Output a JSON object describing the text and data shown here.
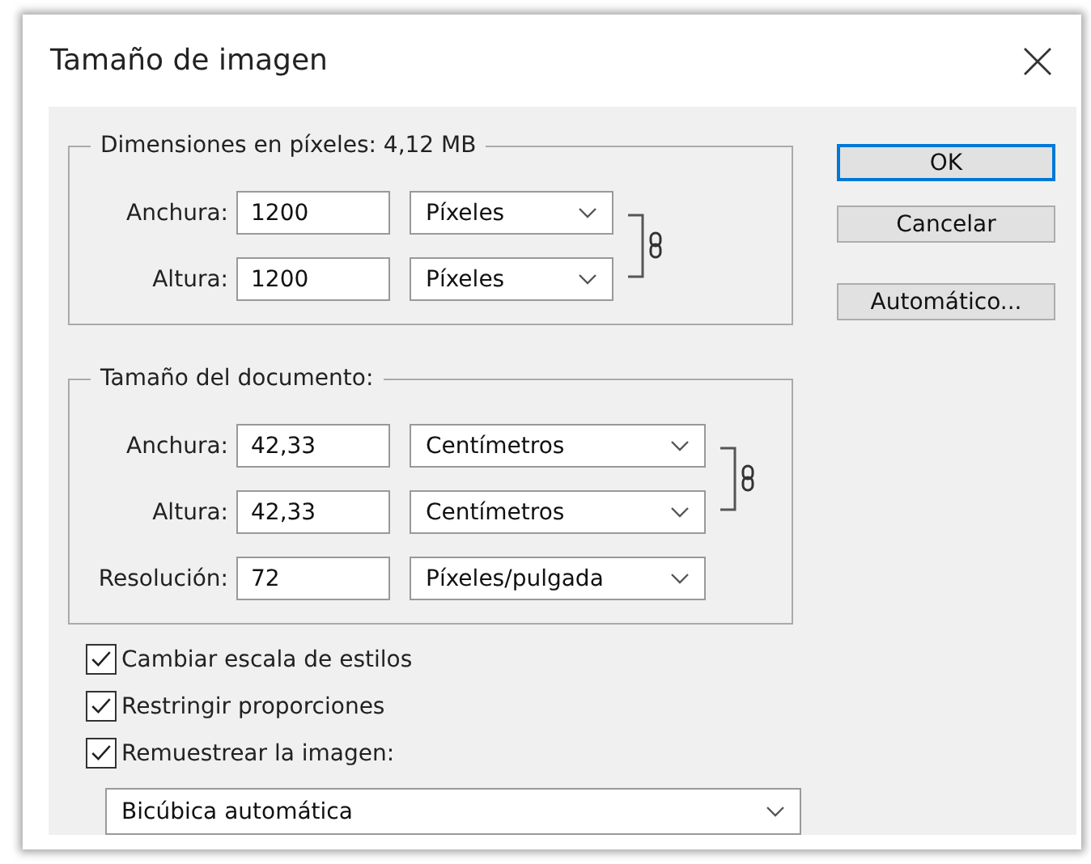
{
  "window": {
    "title": "Tamaño de imagen"
  },
  "pixel_dimensions": {
    "legend": "Dimensiones en píxeles: 4,12 MB",
    "linked": true,
    "linked_rows": [
      {
        "label": "Anchura:",
        "value": "1200",
        "unit": "Píxeles"
      },
      {
        "label": "Altura:",
        "value": "1200",
        "unit": "Píxeles"
      }
    ]
  },
  "document_size": {
    "legend": "Tamaño del documento:",
    "linked": true,
    "linked_rows": [
      {
        "label": "Anchura:",
        "value": "42,33",
        "unit": "Centímetros"
      },
      {
        "label": "Altura:",
        "value": "42,33",
        "unit": "Centímetros"
      }
    ],
    "rows": [
      {
        "label": "Resolución:",
        "value": "72",
        "unit": "Píxeles/pulgada"
      }
    ]
  },
  "checkboxes": [
    {
      "label": "Cambiar escala de estilos",
      "checked": true
    },
    {
      "label": "Restringir proporciones",
      "checked": true
    },
    {
      "label": "Remuestrear la imagen:",
      "checked": true
    }
  ],
  "resample_method": "Bicúbica automática",
  "buttons": [
    {
      "label": "OK",
      "default": true
    },
    {
      "label": "Cancelar",
      "default": false
    },
    {
      "label": "Automático...",
      "default": false
    }
  ]
}
